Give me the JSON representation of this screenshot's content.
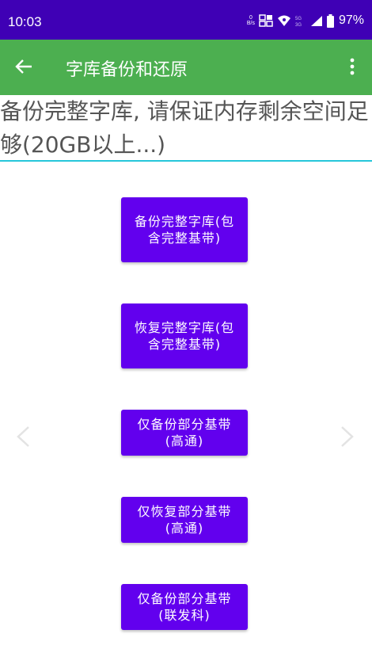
{
  "status_bar": {
    "time": "10:03",
    "net_speed_value": "0",
    "net_speed_unit": "B/s",
    "network_labels": [
      "5G",
      "3G"
    ],
    "battery": "97%"
  },
  "app_bar": {
    "title": "字库备份和还原"
  },
  "warning": {
    "text": "备份完整字库, 请保证内存剩余空间足够(20GB以上...)"
  },
  "buttons": [
    {
      "label": "备份完整字库(包含完整基带)"
    },
    {
      "label": "恢复完整字库(包含完整基带)"
    },
    {
      "label": "仅备份部分基带(高通)"
    },
    {
      "label": "仅恢复部分基带(高通)"
    },
    {
      "label": "仅备份部分基带(联发科)"
    }
  ],
  "colors": {
    "status_bar": "#3f00b5",
    "app_bar": "#4caf50",
    "button": "#6200ee",
    "underline": "#26c6da"
  }
}
